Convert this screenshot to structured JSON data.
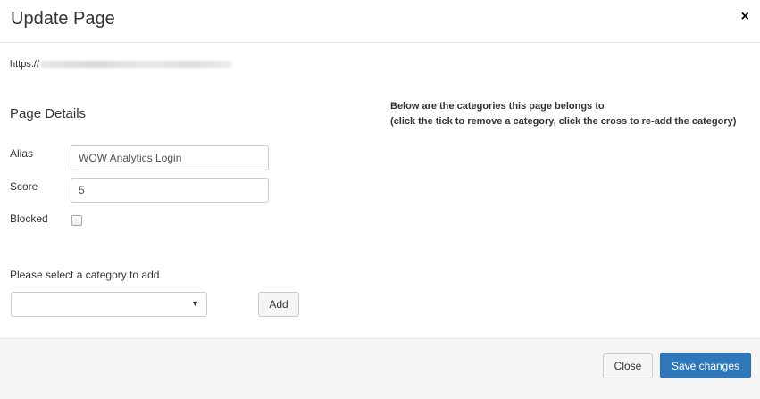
{
  "header": {
    "title": "Update Page",
    "close_glyph": "×",
    "close_icon": "close-icon"
  },
  "url": {
    "prefix": "https://"
  },
  "details": {
    "section_title": "Page Details",
    "alias": {
      "label": "Alias",
      "value": "WOW Analytics Login"
    },
    "score": {
      "label": "Score",
      "value": "5"
    },
    "blocked": {
      "label": "Blocked",
      "checked": false
    }
  },
  "category": {
    "select_label": "Please select a category to add",
    "selected_value": "",
    "dropdown_icon": "chevron-down-icon",
    "add_label": "Add"
  },
  "categories_panel": {
    "line1": "Below are the categories this page belongs to",
    "line2": "(click the tick to remove a category, click the cross to re-add the category)"
  },
  "footer": {
    "close_label": "Close",
    "save_label": "Save changes"
  },
  "colors": {
    "primary": "#2e77b9",
    "footer_bg": "#f5f5f5",
    "border": "#cccccc"
  }
}
